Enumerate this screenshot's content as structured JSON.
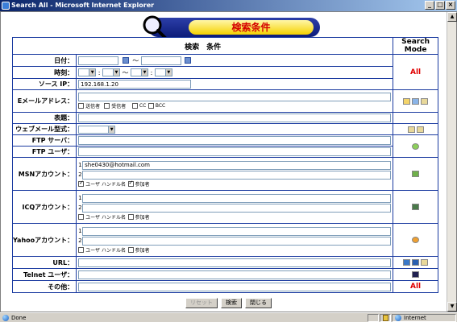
{
  "window": {
    "title": "Search All - Microsoft Internet Explorer",
    "buttons": [
      "_",
      "□",
      "×"
    ]
  },
  "header": {
    "title": "検索条件"
  },
  "table": {
    "col_conditions": "検索　条件",
    "col_mode": "Search Mode",
    "rows": {
      "date": {
        "label": "日付：",
        "sep": "～"
      },
      "time": {
        "label": "時刻：",
        "sep": "～"
      },
      "source_ip": {
        "label": "ソース IP：",
        "value": "192.168.1.20"
      },
      "email": {
        "label": "Eメールアドレス：",
        "checks": [
          "送信者",
          "受信者",
          "CC",
          "BCC"
        ]
      },
      "subject": {
        "label": "表題："
      },
      "webmail": {
        "label": "ウェブメール型式："
      },
      "ftp_server": {
        "label": "FTP サーバ："
      },
      "ftp_user": {
        "label": "FTP ユーザ："
      },
      "msn": {
        "label": "MSNアカウント：",
        "line1": "she0430@hotmail.com",
        "check1": "ユーザ ハンドル名",
        "check2": "参加者"
      },
      "icq": {
        "label": "ICQアカウント：",
        "check1": "ユーザ ハンドル名",
        "check2": "参加者"
      },
      "yahoo": {
        "label": "Yahooアカウント：",
        "check1": "ユーザ ハンドル名",
        "check2": "参加者"
      },
      "url": {
        "label": "URL："
      },
      "telnet": {
        "label": "Telnet ユーザ："
      },
      "other": {
        "label": "その他："
      }
    },
    "mode_all": "All"
  },
  "buttons": {
    "reset": "リセット",
    "search": "検索",
    "close": "閉じる"
  },
  "status": {
    "left": "Done",
    "zone": "Internet"
  },
  "colors": {
    "accent_red": "#e00000",
    "border_blue": "#1a3aa0",
    "pill_blue": "#0d1d7a",
    "pill_yellow": "#f5d200"
  }
}
